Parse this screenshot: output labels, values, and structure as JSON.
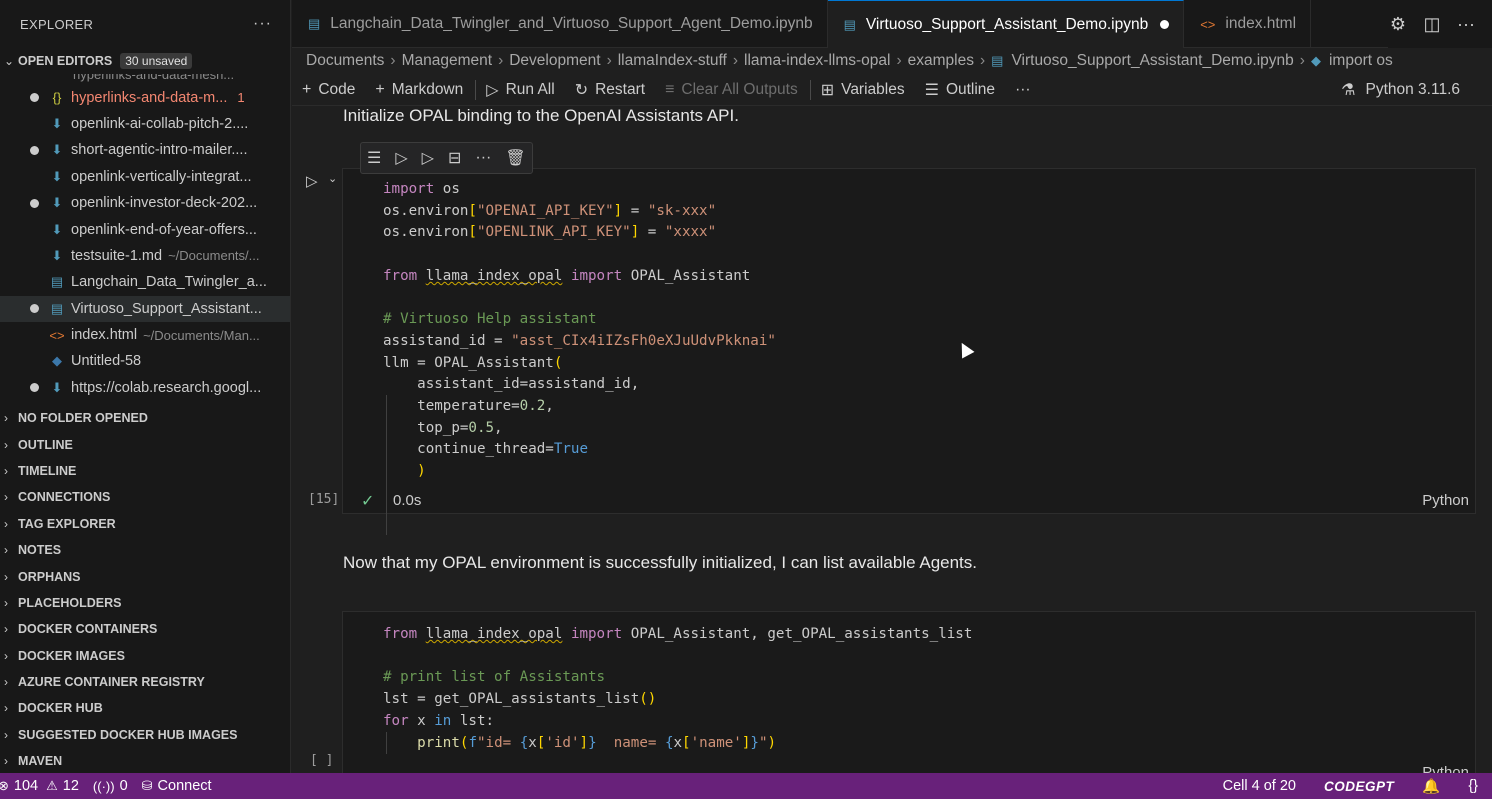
{
  "sidebar": {
    "title": "EXPLORER",
    "more": "···",
    "open_editors": {
      "label": "OPEN EDITORS",
      "badge": "30 unsaved"
    },
    "editors": [
      {
        "name": "hyperlinks-and-data-m...",
        "desc": "",
        "icon": "{}",
        "dirty": true,
        "error": true,
        "errors": "1"
      },
      {
        "name": "openlink-ai-collab-pitch-2....",
        "desc": "",
        "icon": "⬇",
        "dirty": false
      },
      {
        "name": "short-agentic-intro-mailer....",
        "desc": "",
        "icon": "⬇",
        "dirty": true
      },
      {
        "name": "openlink-vertically-integrat...",
        "desc": "",
        "icon": "⬇",
        "dirty": false
      },
      {
        "name": "openlink-investor-deck-202...",
        "desc": "",
        "icon": "⬇",
        "dirty": true
      },
      {
        "name": "openlink-end-of-year-offers...",
        "desc": "",
        "icon": "⬇",
        "dirty": false
      },
      {
        "name": "testsuite-1.md",
        "desc": "~/Documents/...",
        "icon": "⬇",
        "dirty": false
      },
      {
        "name": "Langchain_Data_Twingler_a...",
        "desc": "",
        "icon": "▤",
        "dirty": false
      },
      {
        "name": "Virtuoso_Support_Assistant...",
        "desc": "",
        "icon": "▤",
        "dirty": true,
        "selected": true
      },
      {
        "name": "index.html",
        "desc": "~/Documents/Man...",
        "icon": "<>",
        "dirty": false
      },
      {
        "name": "Untitled-58",
        "desc": "",
        "icon": "◆",
        "dirty": false
      },
      {
        "name": "https://colab.research.googl...",
        "desc": "",
        "icon": "⬇",
        "dirty": true
      }
    ],
    "sections": [
      "NO FOLDER OPENED",
      "OUTLINE",
      "TIMELINE",
      "CONNECTIONS",
      "TAG EXPLORER",
      "NOTES",
      "ORPHANS",
      "PLACEHOLDERS",
      "DOCKER CONTAINERS",
      "DOCKER IMAGES",
      "AZURE CONTAINER REGISTRY",
      "DOCKER HUB",
      "SUGGESTED DOCKER HUB IMAGES",
      "MAVEN"
    ]
  },
  "tabs": [
    {
      "label": "Langchain_Data_Twingler_and_Virtuoso_Support_Agent_Demo.ipynb",
      "active": false
    },
    {
      "label": "Virtuoso_Support_Assistant_Demo.ipynb",
      "active": true
    },
    {
      "label": "index.html",
      "active": false
    }
  ],
  "breadcrumb": [
    "Documents",
    "Management",
    "Development",
    "llamaIndex-stuff",
    "llama-index-llms-opal",
    "examples",
    "Virtuoso_Support_Assistant_Demo.ipynb",
    "import os"
  ],
  "toolbar": {
    "code": "Code",
    "markdown": "Markdown",
    "run_all": "Run All",
    "restart": "Restart",
    "clear": "Clear All Outputs",
    "variables": "Variables",
    "outline": "Outline",
    "more": "···",
    "kernel": "Python 3.11.6"
  },
  "notebook": {
    "md1": "Initialize OPAL binding to the OpenAI Assistants API.",
    "cell1": {
      "exec": "[15]",
      "time": "0.0s",
      "lang": "Python"
    },
    "md2": "Now that my OPAL environment is successfully initialized, I can list available Agents.",
    "cell2": {
      "exec": "[ ]",
      "lang": "Python"
    }
  },
  "statusbar": {
    "errors": "104",
    "warnings": "12",
    "ports": "0",
    "connect": "Connect",
    "cell": "Cell 4 of 20",
    "codegpt": "CODEGPT",
    "braces": "{}"
  },
  "colors": {
    "statusbar": "#68217a",
    "accent": "#0078d4"
  }
}
